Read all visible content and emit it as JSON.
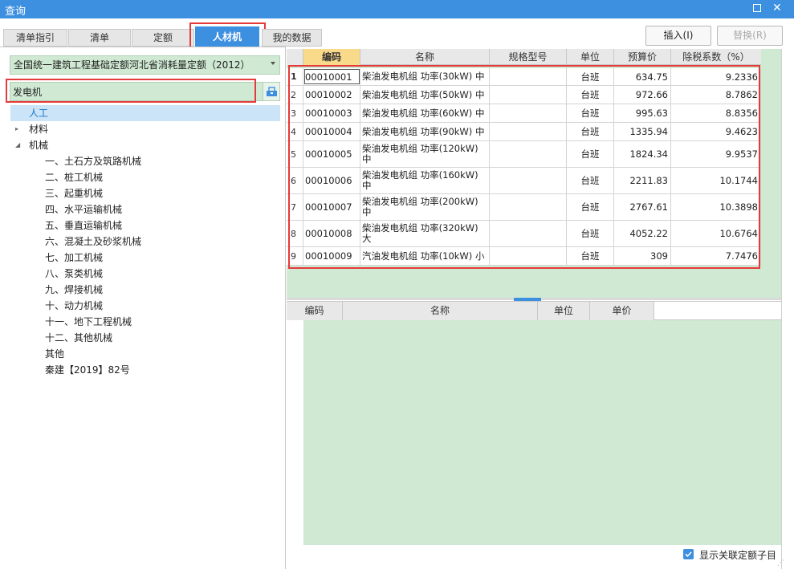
{
  "window": {
    "title": "查询",
    "maximize_label": "□",
    "close_label": "✕"
  },
  "tabs": [
    {
      "label": "清单指引"
    },
    {
      "label": "清单"
    },
    {
      "label": "定额"
    },
    {
      "label": "人材机"
    },
    {
      "label": "我的数据"
    }
  ],
  "actions": {
    "insert_label": "插入(I)",
    "replace_label": "替换(R)"
  },
  "quota_library": {
    "selected": "全国统一建筑工程基础定额河北省消耗量定额（2012）"
  },
  "search": {
    "value": "发电机"
  },
  "tree": {
    "items": [
      {
        "label": "人工"
      },
      {
        "label": "材料"
      },
      {
        "label": "机械"
      },
      {
        "label": "一、土石方及筑路机械"
      },
      {
        "label": "二、桩工机械"
      },
      {
        "label": "三、起重机械"
      },
      {
        "label": "四、水平运输机械"
      },
      {
        "label": "五、垂直运输机械"
      },
      {
        "label": "六、混凝土及砂浆机械"
      },
      {
        "label": "七、加工机械"
      },
      {
        "label": "八、泵类机械"
      },
      {
        "label": "九、焊接机械"
      },
      {
        "label": "十、动力机械"
      },
      {
        "label": "十一、地下工程机械"
      },
      {
        "label": "十二、其他机械"
      },
      {
        "label": "其他"
      },
      {
        "label": "秦建【2019】82号"
      }
    ],
    "expander_collapsed": "▸",
    "expander_expanded": "◢"
  },
  "results": {
    "headers": [
      "编码",
      "名称",
      "规格型号",
      "单位",
      "预算价",
      "除税系数（%）"
    ],
    "rows": [
      {
        "num": "1",
        "code": "00010001",
        "name": "柴油发电机组 功率(30kW) 中",
        "spec": "",
        "unit": "台班",
        "price": "634.75",
        "tax": "9.2336"
      },
      {
        "num": "2",
        "code": "00010002",
        "name": "柴油发电机组 功率(50kW) 中",
        "spec": "",
        "unit": "台班",
        "price": "972.66",
        "tax": "8.7862"
      },
      {
        "num": "3",
        "code": "00010003",
        "name": "柴油发电机组 功率(60kW) 中",
        "spec": "",
        "unit": "台班",
        "price": "995.63",
        "tax": "8.8356"
      },
      {
        "num": "4",
        "code": "00010004",
        "name": "柴油发电机组 功率(90kW) 中",
        "spec": "",
        "unit": "台班",
        "price": "1335.94",
        "tax": "9.4623"
      },
      {
        "num": "5",
        "code": "00010005",
        "name": "柴油发电机组 功率(120kW) 中",
        "spec": "",
        "unit": "台班",
        "price": "1824.34",
        "tax": "9.9537"
      },
      {
        "num": "6",
        "code": "00010006",
        "name": "柴油发电机组 功率(160kW) 中",
        "spec": "",
        "unit": "台班",
        "price": "2211.83",
        "tax": "10.1744"
      },
      {
        "num": "7",
        "code": "00010007",
        "name": "柴油发电机组 功率(200kW) 中",
        "spec": "",
        "unit": "台班",
        "price": "2767.61",
        "tax": "10.3898"
      },
      {
        "num": "8",
        "code": "00010008",
        "name": "柴油发电机组 功率(320kW) 大",
        "spec": "",
        "unit": "台班",
        "price": "4052.22",
        "tax": "10.6764"
      },
      {
        "num": "9",
        "code": "00010009",
        "name": "汽油发电机组 功率(10kW) 小",
        "spec": "",
        "unit": "台班",
        "price": "309",
        "tax": "7.7476"
      }
    ]
  },
  "sub_grid": {
    "headers": [
      "编码",
      "名称",
      "单位",
      "单价"
    ]
  },
  "footer": {
    "checkbox_label": "显示关联定额子目",
    "checked": true
  },
  "colors": {
    "accent": "#3d8fe0",
    "highlight": "#e53a3a",
    "grid_bg": "#cfe9d3",
    "selected_bg": "#cce4f7"
  }
}
